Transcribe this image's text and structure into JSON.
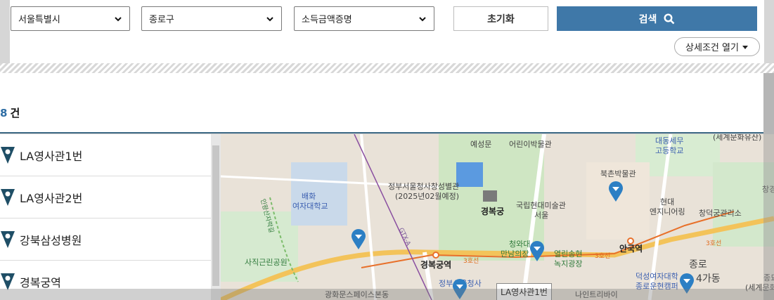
{
  "filters": {
    "city": "서울특별시",
    "district": "종로구",
    "sort": "소득금액증명",
    "reset_label": "초기화",
    "search_label": "검색",
    "detail_label": "상세조건 열기"
  },
  "results": {
    "count": "8",
    "count_suffix": "건"
  },
  "list": {
    "items": [
      {
        "label": "LA영사관1번"
      },
      {
        "label": "LA영사관2번"
      },
      {
        "label": "강북삼성병원"
      },
      {
        "label": "경복궁역"
      }
    ]
  },
  "map": {
    "labels": {
      "yesungmun": "예성문",
      "children_museum": "어린이박물관",
      "daedong": "대동세무",
      "daedong2": "고등학교",
      "world_heritage": "(세계문화유산)",
      "gov_complex": "정부서울청사창성별관",
      "gov_complex2": "(2025년02월예정)",
      "paehwa": "배화",
      "paehwa2": "여자대학교",
      "gyeongbokgung": "경복궁",
      "mmca": "국립현대미술관",
      "mmca2": "서울",
      "bukchon": "북촌박물관",
      "hyundai": "현대",
      "hyundai2": "엔지니어링",
      "changdeok": "창덕궁관리소",
      "changgyeong": "창경",
      "cheongwadae": "청와대",
      "cheongwadae2": "만남의장",
      "yeolinsong": "열린송현",
      "yeolinsong2": "녹지광장",
      "anguk": "안국역",
      "sajik": "사직근린공원",
      "gyeongbokgung_stn": "경복궁역",
      "line3_a": "3호선",
      "line3_b": "3호선",
      "line3_c": "3호선",
      "duksung": "덕성여자대학",
      "duksung2": "종로운현캠퍼",
      "jongro": "종로",
      "jongro_4ga": "4가동",
      "jongmyo": "종묘",
      "jongmyo2": "(세계문화",
      "gwanghwamun": "광화문스페이스본동",
      "gov_seoul": "정부서울청사",
      "nine_tree": "나인트리바이",
      "gtx": "GTX-A",
      "trail": "인왕산자락길"
    },
    "callout": "LA영사관1번"
  },
  "colors": {
    "search_button": "#3f78a8",
    "pin": "#2c7fc4",
    "list_pin": "#1f4e66",
    "accent_count": "#2e6da4"
  }
}
